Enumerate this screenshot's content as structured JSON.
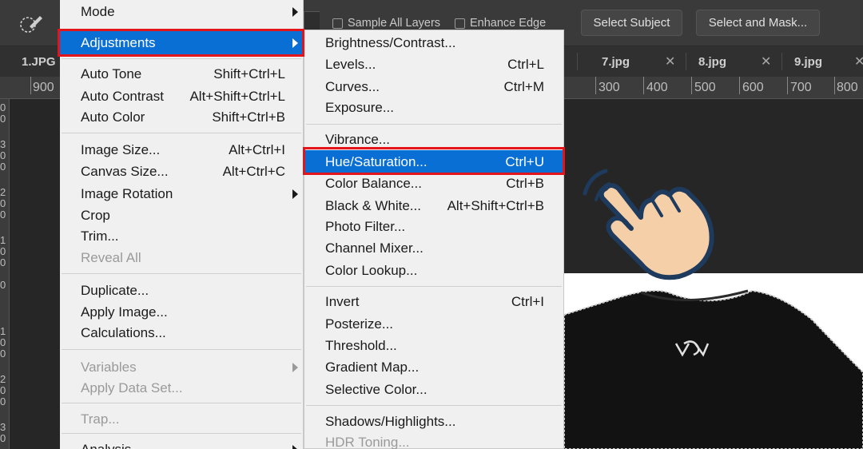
{
  "optbar": {
    "sample_all_layers": "Sample All Layers",
    "enhance_edge": "Enhance Edge",
    "select_subject": "Select Subject",
    "select_and_mask": "Select and Mask..."
  },
  "tabs": [
    {
      "label": "1.JPG"
    },
    {
      "label": "7.jpg"
    },
    {
      "label": "8.jpg"
    },
    {
      "label": "9.jpg"
    }
  ],
  "ruler": {
    "left_label": "900",
    "labels": [
      "300",
      "400",
      "500",
      "600",
      "700",
      "800"
    ],
    "vertical_digits": [
      "0",
      "0",
      "3",
      "0",
      "0",
      "2",
      "0",
      "0",
      "1",
      "0",
      "0",
      "0",
      "1",
      "0",
      "0",
      "2",
      "0",
      "0",
      "3",
      "0"
    ]
  },
  "image_menu": {
    "items": {
      "mode": "Mode",
      "adjustments": "Adjustments",
      "auto_tone": "Auto Tone",
      "auto_tone_short": "Shift+Ctrl+L",
      "auto_contrast": "Auto Contrast",
      "auto_contrast_short": "Alt+Shift+Ctrl+L",
      "auto_color": "Auto Color",
      "auto_color_short": "Shift+Ctrl+B",
      "image_size": "Image Size...",
      "image_size_short": "Alt+Ctrl+I",
      "canvas_size": "Canvas Size...",
      "canvas_size_short": "Alt+Ctrl+C",
      "image_rotation": "Image Rotation",
      "crop": "Crop",
      "trim": "Trim...",
      "reveal_all": "Reveal All",
      "duplicate": "Duplicate...",
      "apply_image": "Apply Image...",
      "calculations": "Calculations...",
      "variables": "Variables",
      "apply_data_set": "Apply Data Set...",
      "trap": "Trap...",
      "analysis": "Analysis"
    }
  },
  "adjustments_menu": {
    "items": {
      "brightness_contrast": "Brightness/Contrast...",
      "levels": "Levels...",
      "levels_short": "Ctrl+L",
      "curves": "Curves...",
      "curves_short": "Ctrl+M",
      "exposure": "Exposure...",
      "vibrance": "Vibrance...",
      "hue_saturation": "Hue/Saturation...",
      "hue_saturation_short": "Ctrl+U",
      "color_balance": "Color Balance...",
      "color_balance_short": "Ctrl+B",
      "black_white": "Black & White...",
      "black_white_short": "Alt+Shift+Ctrl+B",
      "photo_filter": "Photo Filter...",
      "channel_mixer": "Channel Mixer...",
      "color_lookup": "Color Lookup...",
      "invert": "Invert",
      "invert_short": "Ctrl+I",
      "posterize": "Posterize...",
      "threshold": "Threshold...",
      "gradient_map": "Gradient Map...",
      "selective_color": "Selective Color...",
      "shadows_highlights": "Shadows/Highlights...",
      "hdr_toning": "HDR Toning..."
    }
  },
  "colors": {
    "highlight": "#0a6fd4",
    "annotation_red": "#e3151b",
    "hand_skin": "#f5cfa8",
    "hand_outline": "#1e3a5c"
  },
  "icons": [
    "quick-selection-brush-icon",
    "submenu-arrow-icon",
    "tab-close-icon",
    "pointing-hand-icon"
  ]
}
